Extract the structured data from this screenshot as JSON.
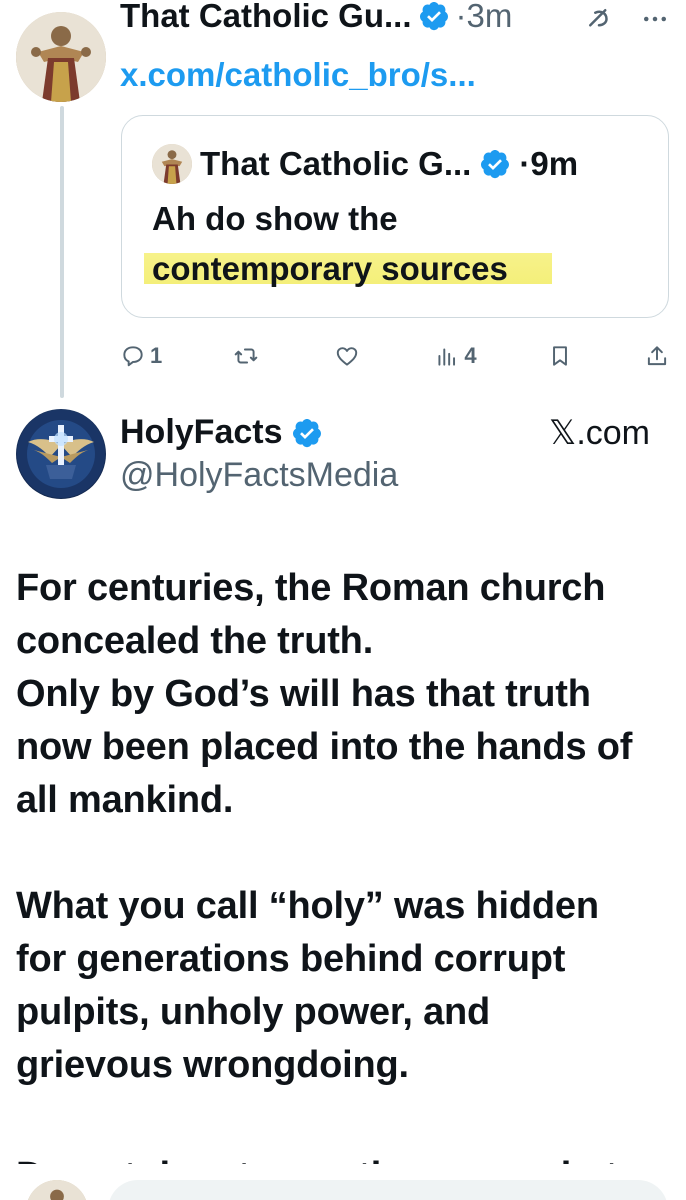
{
  "parent_tweet": {
    "author_name": "That Catholic Gu...",
    "time": "·3m",
    "link": "x.com/catholic_bro/s...",
    "quoted": {
      "author_name": "That Catholic G...",
      "time": "·9m",
      "text_line1": "Ah do show the",
      "text_highlight": "contemporary sources"
    },
    "actions": {
      "replies": "1",
      "reposts": "",
      "likes": "",
      "views": "4"
    }
  },
  "card": {
    "name": "HolyFacts",
    "handle": "@HolyFactsMedia",
    "source": "𝕏.com",
    "para1": [
      "For centuries, the Roman church",
      "concealed the truth.",
      "Only by God’s will has that truth",
      "now been placed into the hands of",
      "all mankind."
    ],
    "para2": [
      "What you call “holy” was hidden",
      "for generations behind corrupt",
      "pulpits, unholy power, and",
      "grievous wrongdoing."
    ],
    "cut_off": "Do not dare to say they owe what"
  },
  "colors": {
    "accent": "#1d9bf0",
    "text": "#0f1419",
    "secondary": "#536471",
    "highlight": "#f4ef7a"
  }
}
